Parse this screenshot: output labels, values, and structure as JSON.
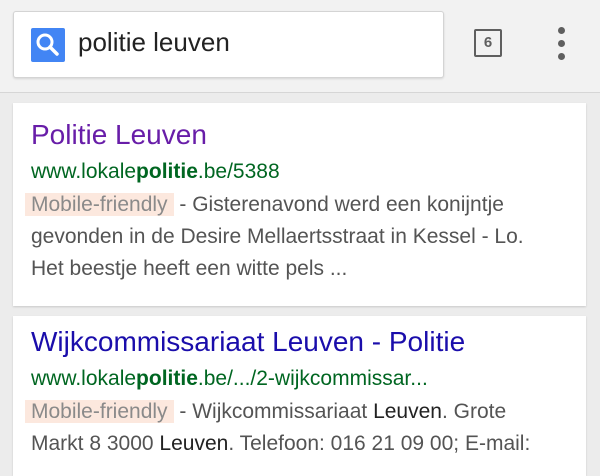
{
  "search": {
    "query": "politie leuven",
    "tab_count": "6"
  },
  "colors": {
    "visited_link": "#681da8",
    "link": "#1a0dab",
    "url_green": "#006621",
    "badge_bg": "#fce8de"
  },
  "icons": {
    "search": "search-icon",
    "tabs": "tabs-icon",
    "menu": "overflow-menu-icon"
  },
  "results": [
    {
      "title": "Politie Leuven",
      "url_prefix": "www.lokale",
      "url_bold": "politie",
      "url_suffix": ".be/5388",
      "badge": "Mobile-friendly",
      "snippet_line1": " - Gisterenavond werd een konijntje",
      "snippet_line2": "gevonden in de Desire Mellaertsstraat in Kessel - Lo.",
      "snippet_line3": "Het beestje heeft een witte pels ..."
    },
    {
      "title": "Wijkcommissariaat Leuven - Politie",
      "url_prefix": "www.lokale",
      "url_bold": "politie",
      "url_suffix": ".be/.../2-wijkcommissar...",
      "badge": "Mobile-friendly",
      "snippet_a": " - Wijkcommissariaat ",
      "snippet_b": "Leuven",
      "snippet_c": ". Grote",
      "snippet_d": "Markt 8 3000 ",
      "snippet_e": "Leuven",
      "snippet_f": ". Telefoon: 016 21 09 00; E-mail:"
    }
  ]
}
